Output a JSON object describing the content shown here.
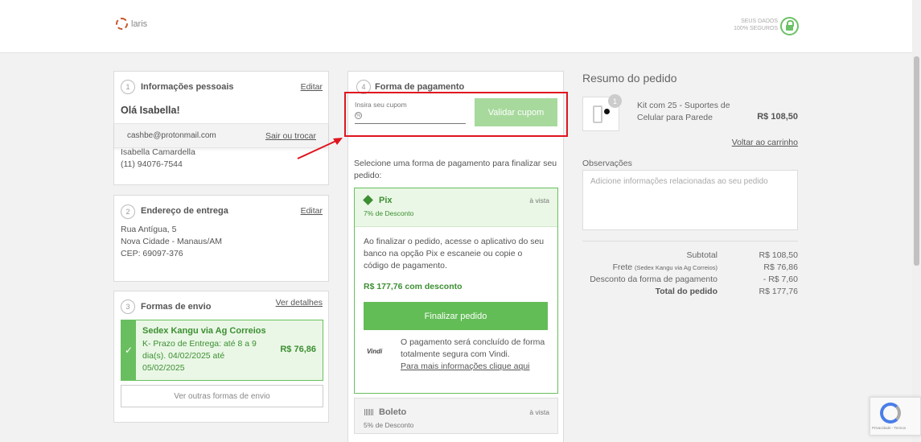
{
  "header": {
    "logo_text": "laris",
    "secure_line1": "SEUS DADOS",
    "secure_line2": "100% SEGUROS"
  },
  "personal": {
    "step": "1",
    "title": "Informações pessoais",
    "edit": "Editar",
    "greeting": "Olá Isabella!",
    "email": "cashbe@protonmail.com",
    "switch": "Sair ou trocar",
    "name": "Isabella Camardella",
    "phone": "(11) 94076-7544"
  },
  "address": {
    "step": "2",
    "title": "Endereço de entrega",
    "edit": "Editar",
    "line1": "Rua Antígua, 5",
    "line2": "Nova Cidade - Manaus/AM",
    "line3": "CEP: 69097-376"
  },
  "shipping": {
    "step": "3",
    "title": "Formas de envio",
    "details": "Ver detalhes",
    "option_name": "Sedex Kangu via Ag Correios",
    "option_desc": "K- Prazo de Entrega: até 8 a 9 dia(s). 04/02/2025 até 05/02/2025",
    "option_price": "R$ 76,86",
    "other": "Ver outras formas de envio"
  },
  "payment": {
    "step": "4",
    "title": "Forma de pagamento",
    "coupon_label": "Insira seu cupom",
    "coupon_value": "",
    "validate": "Validar cupom",
    "select_text": "Selecione uma forma de pagamento para finalizar seu pedido:",
    "pix": {
      "name": "Pix",
      "discount": "7% de Desconto",
      "avista": "à vista",
      "text": "Ao finalizar o pedido, acesse o aplicativo do seu banco na opção Pix e escaneie ou copie o código de pagamento.",
      "price": "R$ 177,76 com desconto",
      "button": "Finalizar pedido",
      "vindi_logo": "Vindi",
      "vindi_text": "O pagamento será concluído de forma totalmente segura com Vindi.",
      "vindi_link": "Para mais informações clique aqui"
    },
    "boleto": {
      "name": "Boleto",
      "discount": "5% de Desconto",
      "avista": "à vista"
    }
  },
  "summary": {
    "title": "Resumo do pedido",
    "qty": "1",
    "product_name": "Kit com 25 - Suportes de Celular para Parede",
    "product_price": "R$ 108,50",
    "back": "Voltar ao carrinho",
    "obs_label": "Observações",
    "obs_placeholder": "Adicione informações relacionadas ao seu pedido",
    "subtotal_label": "Subtotal",
    "subtotal": "R$ 108,50",
    "frete_label": "Frete",
    "frete_detail": "(Sedex Kangu via Ag Correios)",
    "frete": "R$ 76,86",
    "desconto_label": "Desconto da forma de pagamento",
    "desconto": "- R$ 7,60",
    "total_label": "Total do pedido",
    "total": "R$ 177,76"
  },
  "recaptcha": {
    "text": "Privacidade - Termos"
  },
  "colors": {
    "accent_green": "#63bd57",
    "highlight_red": "#e0141e"
  }
}
